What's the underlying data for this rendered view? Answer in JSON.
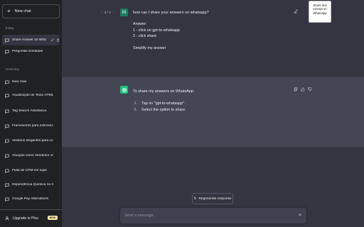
{
  "sidebar": {
    "new_chat_label": "New chat",
    "sections": [
      {
        "label": "Today"
      },
      {
        "label": "Yesterday"
      }
    ],
    "today_items": [
      {
        "label": "Share Answer on Whatsa"
      },
      {
        "label": "Perguntas ilimitadas"
      }
    ],
    "yesterday_items": [
      {
        "label": "New chat"
      },
      {
        "label": "Atualização de Texto HTML"
      },
      {
        "label": "Tag Search Assistance"
      },
      {
        "label": "Frameworks para extensões"
      },
      {
        "label": "Vestidos elegantes para casa"
      },
      {
        "label": "Atuação como Vendedor de R"
      },
      {
        "label": "Falta de CRM em lojas"
      },
      {
        "label": "Dependência Química no Brasil"
      },
      {
        "label": "Google Pay Alternatives"
      }
    ],
    "upgrade_label": "Upgrade to Plus",
    "new_badge": "NEW"
  },
  "conversation": {
    "pager": "4 / 4",
    "user_avatar": "M",
    "user_message": [
      "how can I share your answers on whatsapp?",
      "",
      "Answer:",
      "1 - click on gpt-to-whatsapp",
      "2 - click share",
      "",
      "Simplify my answer"
    ],
    "tooltip": [
      "Share last",
      "prompt on",
      "Whatsapp"
    ],
    "assistant_intro": "To share my answers on WhatsApp:",
    "assistant_steps": [
      {
        "num": "1.",
        "text": "Tap on \"gpt-to-whatsapp\"."
      },
      {
        "num": "2.",
        "text": "Select the option to share."
      }
    ]
  },
  "regenerate_label": "Regenerate response",
  "composer": {
    "placeholder": "Send a message.",
    "value": ""
  },
  "colors": {
    "sidebar": "#202123",
    "main": "#343541",
    "assistant_row": "#444654",
    "accent": "#19c37d"
  }
}
